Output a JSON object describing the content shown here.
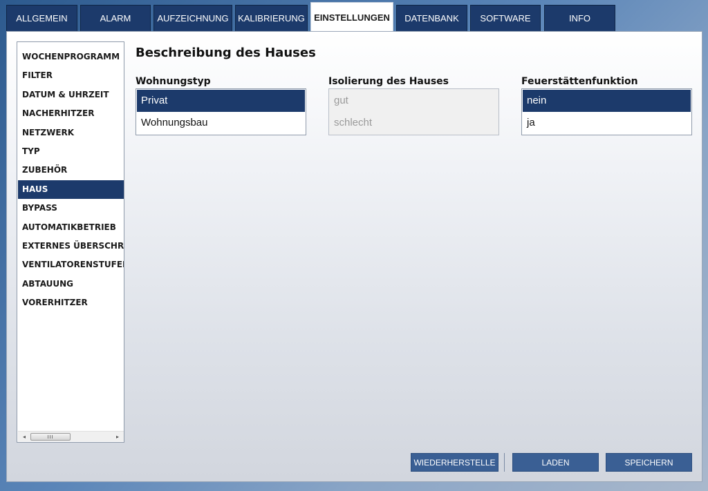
{
  "tabs": [
    {
      "label": "ALLGEMEIN"
    },
    {
      "label": "ALARM"
    },
    {
      "label": "AUFZEICHNUNG"
    },
    {
      "label": "KALIBRIERUNG"
    },
    {
      "label": "EINSTELLUNGEN",
      "active": true
    },
    {
      "label": "DATENBANK"
    },
    {
      "label": "SOFTWARE"
    },
    {
      "label": "INFO"
    }
  ],
  "sidebar": {
    "items": [
      {
        "label": "WOCHENPROGRAMM"
      },
      {
        "label": "FILTER"
      },
      {
        "label": "DATUM & UHRZEIT"
      },
      {
        "label": "NACHERHITZER"
      },
      {
        "label": "NETZWERK"
      },
      {
        "label": "TYP"
      },
      {
        "label": "ZUBEHÖR"
      },
      {
        "label": "HAUS",
        "active": true
      },
      {
        "label": "BYPASS"
      },
      {
        "label": "AUTOMATIKBETRIEB"
      },
      {
        "label": "EXTERNES ÜBERSCHREIBEN"
      },
      {
        "label": "VENTILATORENSTUFEN"
      },
      {
        "label": "ABTAUUNG"
      },
      {
        "label": "VORERHITZER"
      }
    ],
    "scrollbar": {
      "left_arrow": "◂",
      "right_arrow": "▸",
      "thumb_grip": "III"
    }
  },
  "main": {
    "title": "Beschreibung des Hauses",
    "groups": [
      {
        "label": "Wohnungstyp",
        "enabled": true,
        "options": [
          "Privat",
          "Wohnungsbau"
        ],
        "selected": "Privat"
      },
      {
        "label": "Isolierung des Hauses",
        "enabled": false,
        "options": [
          "gut",
          "schlecht"
        ],
        "selected": null
      },
      {
        "label": "Feuerstättenfunktion",
        "enabled": true,
        "options": [
          "nein",
          "ja"
        ],
        "selected": "nein"
      }
    ]
  },
  "buttons": {
    "restore_label": "WIEDERHERSTELLE",
    "load_label": "LADEN",
    "save_label": "SPEICHERN"
  },
  "colors": {
    "accent": "#1c3a6b",
    "button": "#3a5f94"
  }
}
